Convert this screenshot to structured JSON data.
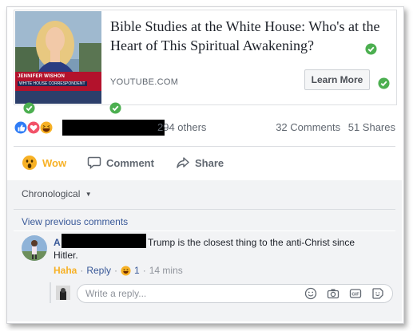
{
  "post": {
    "preview": {
      "thumbnail_caption_name": "JENNIFER WISHON",
      "thumbnail_caption_title": "WHITE HOUSE CORRESPONDENT",
      "title": "Bible Studies at the White House: Who's at the Heart of This Spiritual Awakening?",
      "source": "YOUTUBE.COM",
      "cta_label": "Learn More"
    },
    "reactions": {
      "icons": [
        "like-icon",
        "love-icon",
        "haha-icon"
      ],
      "others_text": "294 others",
      "comments_count": "32 Comments",
      "shares_count": "51 Shares"
    },
    "actions": {
      "reaction_label": "Wow",
      "comment_label": "Comment",
      "share_label": "Share"
    },
    "comments": {
      "sort_label": "Chronological",
      "view_previous": "View previous comments",
      "items": [
        {
          "author_initial": "A",
          "text_line1": "Trump is the closest thing to the anti-Christ since",
          "text_line2": "Hitler.",
          "reaction_label": "Haha",
          "reply_label": "Reply",
          "reaction_count": "1",
          "time": "14 mins"
        }
      ],
      "reply_placeholder": "Write a reply..."
    }
  },
  "colors": {
    "link_blue": "#385898",
    "check_green": "#4caf50",
    "haha_yellow": "#f7b125",
    "like_blue": "#2e7cf6",
    "love_red": "#f25268",
    "redaction": "#000000"
  }
}
